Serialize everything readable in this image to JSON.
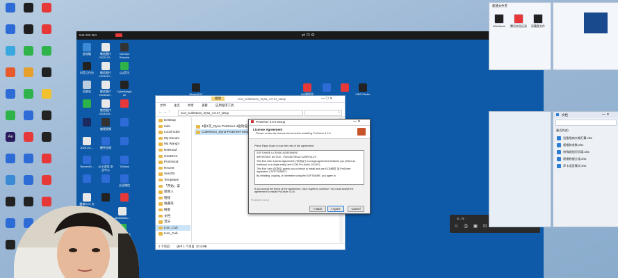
{
  "desktop_left": [
    {
      "label": "",
      "color": "#2d6bd6"
    },
    {
      "label": "",
      "color": "#1f1f1f"
    },
    {
      "label": "",
      "color": "#e63838"
    },
    {
      "label": "",
      "color": "#2d6bd6"
    },
    {
      "label": "",
      "color": "#1f1f1f"
    },
    {
      "label": "",
      "color": "#e63838"
    },
    {
      "label": "",
      "color": "#39a8e0"
    },
    {
      "label": "",
      "color": "#2db34a"
    },
    {
      "label": "",
      "color": "#2db34a"
    },
    {
      "label": "",
      "color": "#e65a2b"
    },
    {
      "label": "",
      "color": "#e6a02b"
    },
    {
      "label": "",
      "color": "#222"
    },
    {
      "label": "",
      "color": "#2d6bd6"
    },
    {
      "label": "",
      "color": "#2db34a"
    },
    {
      "label": "",
      "color": "#f2c12e"
    },
    {
      "label": "",
      "color": "#2db34a"
    },
    {
      "label": "",
      "color": "#2d6bd6"
    },
    {
      "label": "",
      "color": "#222"
    },
    {
      "label": "Ae",
      "color": "#2a1a5e"
    },
    {
      "label": "",
      "color": "#e63838"
    },
    {
      "label": "",
      "color": "#222"
    },
    {
      "label": "",
      "color": "#2d6bd6"
    },
    {
      "label": "",
      "color": "#2d6bd6"
    },
    {
      "label": "",
      "color": "#e63838"
    },
    {
      "label": "",
      "color": "#3a8ad6"
    },
    {
      "label": "",
      "color": "#2d6bd6"
    },
    {
      "label": "",
      "color": "#e63838"
    },
    {
      "label": "",
      "color": "#222"
    },
    {
      "label": "",
      "color": "#222"
    },
    {
      "label": "",
      "color": "#e63838"
    },
    {
      "label": "",
      "color": "#2d6bd6"
    },
    {
      "label": "",
      "color": "#2d6bd6"
    },
    {
      "label": "",
      "color": "#2d6bd6"
    },
    {
      "label": "",
      "color": "#222"
    },
    {
      "label": "",
      "color": "#2d6bd6"
    }
  ],
  "remote": {
    "id_text": "543 280 384",
    "icons": [
      {
        "label": "此电脑",
        "color": "#3a8ad6"
      },
      {
        "label": "微信图片 2023122...",
        "color": "#e8e8e8"
      },
      {
        "label": "DaVinci Resolve",
        "color": "#333"
      },
      {
        "label": "抖音工作台",
        "color": "#222"
      },
      {
        "label": "微信图片 2024021...",
        "color": "#e8e8e8"
      },
      {
        "label": "QQ音乐",
        "color": "#2db34a"
      },
      {
        "label": "回收站",
        "color": "#bcd"
      },
      {
        "label": "微信图片 2024022...",
        "color": "#e8e8e8"
      },
      {
        "label": "CyberMagic AI",
        "color": "#222"
      },
      {
        "label": "",
        "color": "#2db34a"
      },
      {
        "label": "微信图片 2024020...",
        "color": "#e8e8e8"
      },
      {
        "label": "",
        "color": "#e63838"
      },
      {
        "label": "",
        "color": "#1a2a5e"
      },
      {
        "label": "傲视视频",
        "color": "#333"
      },
      {
        "label": "",
        "color": "#2d6bd6"
      },
      {
        "label": "2025-03-...",
        "color": "#e8e8e8"
      },
      {
        "label": "硬件检测",
        "color": "#2d6bd6"
      },
      {
        "label": "",
        "color": "#2d6bd6"
      },
      {
        "label": "TencentD...",
        "color": "#2d6bd6"
      },
      {
        "label": "ACE游戏 安全中心",
        "color": "#2d6bd6"
      },
      {
        "label": "ToDesk",
        "color": "#2d6bd6"
      },
      {
        "label": "",
        "color": "#2d6bd6"
      },
      {
        "label": "",
        "color": "#2d6bd6"
      },
      {
        "label": "企业微信",
        "color": "#2d6bd6"
      },
      {
        "label": "雷神DCK 文档",
        "color": "#e8e8e8"
      },
      {
        "label": "",
        "color": "#222"
      },
      {
        "label": "",
        "color": "#e63838"
      }
    ],
    "top_row": [
      {
        "label": "Studio3/17",
        "color": "#222"
      },
      {
        "label": "QQ截图及OBS Studio",
        "color": "#e63838"
      },
      {
        "label": "",
        "color": "#2d6bd6"
      },
      {
        "label": "",
        "color": "#e63838"
      },
      {
        "label": "OBS Studio",
        "color": "#222"
      }
    ],
    "bottom_icons": [
      {
        "label": "alibilibiliba...",
        "color": "#e8e8e8"
      },
      {
        "label": "360安全 浏览器",
        "color": "#2db34a"
      }
    ]
  },
  "explorer": {
    "tabs": [
      "管理",
      "Icon_CubeNano_Dyna_4.0.17_setup"
    ],
    "title": "Icon_CubeNano_Dyna_4.0.17_setup",
    "ribbon": [
      "文件",
      "主页",
      "共享",
      "查看",
      "应用程序工具"
    ],
    "breadcrumb": "Icon_CubeNano_Dyna_4.0.17_setup",
    "nav": [
      "Desktop",
      "Intel",
      "Local Subs",
      "My Docum",
      "My WangV",
      "NetHood",
      "OneDrive",
      "PrintHood",
      "Recent",
      "SendTo",
      "Templates",
      "「开始」菜",
      "新教人",
      "链接",
      "收藏夹",
      "搜索",
      "文档",
      "音乐",
      "Icon_Cub",
      "Icon_Cub"
    ],
    "files": [
      "4套4次_Dyna ProDriver 4驱动设置文件",
      "CubeNano_Dyna-ProDriver-Setup"
    ],
    "status": {
      "items": "2 个项目",
      "selected": "选中 1 个项目",
      "size": "30.4 MB"
    }
  },
  "setup": {
    "title": "ProDriver 4.2.6 Setup",
    "heading": "License Agreement",
    "subheading": "Please review the license terms before installing ProDriver 4.2.6.",
    "instruction": "Press Page Down to see the rest of the agreement.",
    "license_lines": [
      "SOFTWARE LICENSE AGREEMENT",
      "IMPORTANT NOTICE - PLEASE READ CAREFULLY!",
      "This End User License Agreement (\"本协议\") is a legal agreement between you (either an individual or a single entity) and iCON Pro Audio (\"iCON\").",
      "This End User (本协议) grants you a license to install and use iCON软件 及 ProDriver application (\"SOFTWARE\").",
      "By installing, copying, or otherwise using the SOFTWARE, you agree to"
    ],
    "accept_text": "If you accept the terms of the agreement, click I Agree to continue. You must accept the agreement to install ProDriver 4.2.6.",
    "footer": "ProDriver v4.2.6",
    "buttons": {
      "back": "< Back",
      "agree": "I Agree",
      "cancel": "Cancel"
    }
  },
  "toolbar_small": {
    "title": "cr...fx"
  },
  "right_top": {
    "title": "新建文件夹",
    "icons": [
      {
        "label": "WinGame",
        "color": "#222"
      },
      {
        "label": "腾讯文档记录",
        "color": "#e63838"
      },
      {
        "label": "深藏版文件",
        "color": "#222"
      },
      {
        "label": "090909090",
        "color": "#f2c12e"
      },
      {
        "label": "relesch_202 5031305 7...",
        "color": "#eee"
      },
      {
        "label": "relesch_202 5031305 7...",
        "color": "#1a4a8e"
      },
      {
        "label": "png",
        "color": "#fff"
      },
      {
        "label": "12121.png",
        "color": "#fff"
      }
    ]
  },
  "right_bottom": {
    "title": "文档",
    "filter": "最近的(8)",
    "items": [
      "设备指南大概打算.xlsx",
      "规格和参数.xlsx",
      "特殊规划尺码清.xlsx",
      "规格数据分组.xlsx",
      "声卡混音模式.xlsx"
    ]
  }
}
